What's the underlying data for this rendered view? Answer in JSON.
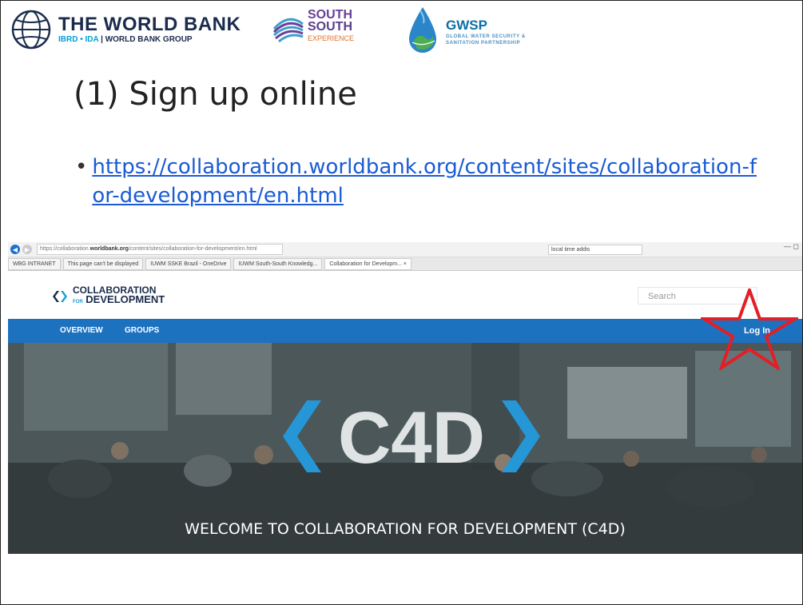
{
  "logos": {
    "world_bank": {
      "title": "THE WORLD BANK",
      "sub_left": "IBRD • IDA",
      "sub_sep": " | ",
      "sub_right": "WORLD BANK GROUP"
    },
    "south_south": {
      "line1": "SOUTH",
      "line2": "SOUTH",
      "line3": "EXPERIENCE"
    },
    "gwsp": {
      "title": "GWSP",
      "subtitle": "GLOBAL WATER SECURITY & SANITATION PARTNERSHIP"
    }
  },
  "slide": {
    "title": "(1) Sign up online",
    "bullet": "•",
    "link": "https://collaboration.worldbank.org/content/sites/collaboration-for-development/en.html"
  },
  "browser": {
    "url_prefix": "https://collaboration.",
    "url_domain": "worldbank.org",
    "url_rest": "/content/sites/collaboration-for-development/en.html",
    "search_value": "local time addis",
    "tabs": [
      "WBG INTRANET",
      "This page can't be displayed",
      "IUWM SSKE Brazil - OneDrive",
      "IUWM South-South Knowledg...",
      "Collaboration for Developm... ×"
    ]
  },
  "site": {
    "logo_line1": "COLLABORATION",
    "logo_for": "FOR",
    "logo_line2": "DEVELOPMENT",
    "search_placeholder": "Search",
    "nav": {
      "overview": "OVERVIEW",
      "groups": "GROUPS",
      "login": "Log In"
    },
    "hero_logo": "C4D",
    "welcome": "WELCOME TO COLLABORATION FOR DEVELOPMENT (C4D)"
  },
  "colors": {
    "link": "#1a5bd4",
    "nav_bar": "#1d72c0",
    "star_outline": "#e41e26",
    "hero_logo_blue": "#2596d6"
  },
  "icons": [
    "world-bank-globe-icon",
    "south-south-swirl-icon",
    "gwsp-drop-icon",
    "c4d-mark-icon",
    "red-star-icon",
    "back-arrow-icon"
  ]
}
